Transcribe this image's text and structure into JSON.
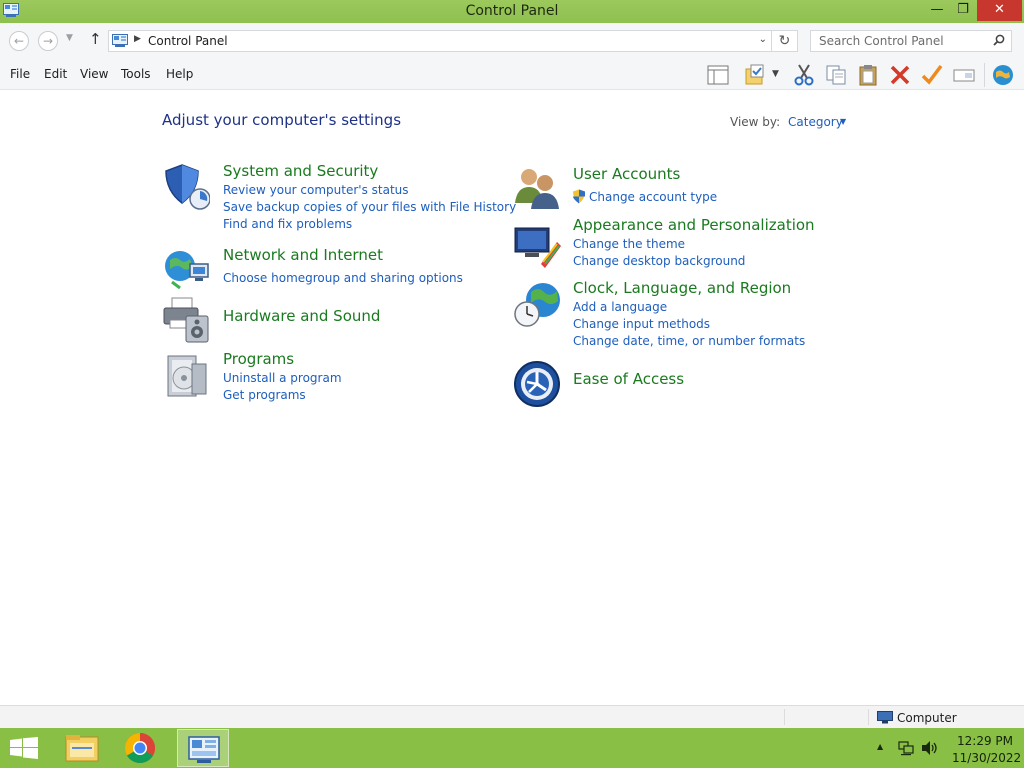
{
  "window": {
    "title": "Control Panel",
    "minimize_glyph": "—",
    "maximize_glyph": "❐",
    "close_glyph": "✕"
  },
  "address_bar": {
    "path": "Control Panel",
    "search_placeholder": "Search Control Panel"
  },
  "menu": {
    "file": "File",
    "edit": "Edit",
    "view": "View",
    "tools": "Tools",
    "help": "Help"
  },
  "toolbar_icons": [
    "layout-pane-icon",
    "folder-properties-icon",
    "cut-icon",
    "copy-icon",
    "paste-icon",
    "delete-icon",
    "checkmark-icon",
    "rename-icon",
    "globe-icon"
  ],
  "main": {
    "heading": "Adjust your computer's settings",
    "view_by_label": "View by:",
    "view_by_value": "Category"
  },
  "categories": {
    "system_security": {
      "title": "System and Security",
      "links": [
        "Review your computer's status",
        "Save backup copies of your files with File History",
        "Find and fix problems"
      ]
    },
    "network_internet": {
      "title": "Network and Internet",
      "links": [
        "Choose homegroup and sharing options"
      ]
    },
    "hardware_sound": {
      "title": "Hardware and Sound",
      "links": []
    },
    "programs": {
      "title": "Programs",
      "links": [
        "Uninstall a program",
        "Get programs"
      ]
    },
    "user_accounts": {
      "title": "User Accounts",
      "links": [
        "Change account type"
      ]
    },
    "appearance": {
      "title": "Appearance and Personalization",
      "links": [
        "Change the theme",
        "Change desktop background"
      ]
    },
    "clock_region": {
      "title": "Clock, Language, and Region",
      "links": [
        "Add a language",
        "Change input methods",
        "Change date, time, or number formats"
      ]
    },
    "ease_access": {
      "title": "Ease of Access",
      "links": []
    }
  },
  "status_bar": {
    "location": "Computer"
  },
  "taskbar": {
    "apps": [
      "file-explorer",
      "chrome",
      "control-panel"
    ],
    "time": "12:29 PM",
    "date": "11/30/2022"
  },
  "colors": {
    "title_bar": "#8ec04f",
    "taskbar": "#8abf45",
    "category_title": "#1a7a1f",
    "link": "#1e5ebd",
    "heading": "#1e3287",
    "close_button": "#c7372d"
  }
}
